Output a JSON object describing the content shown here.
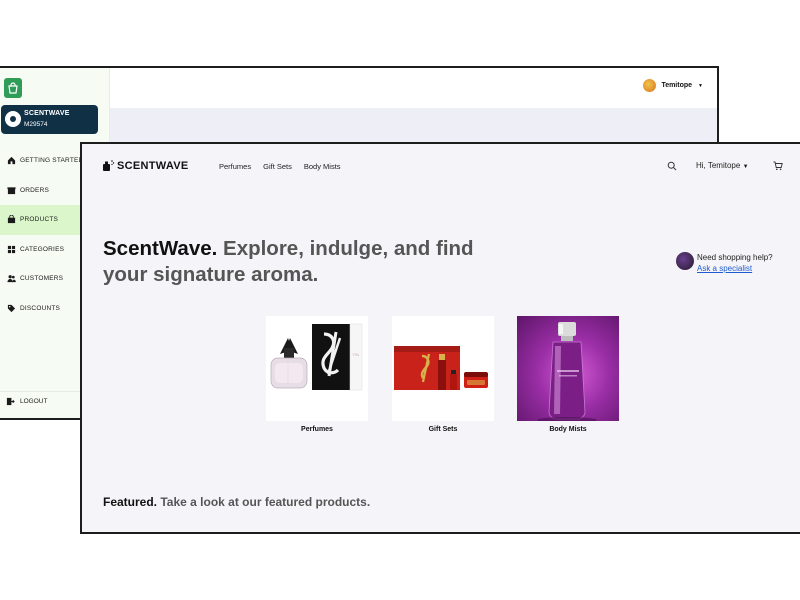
{
  "admin": {
    "store": {
      "name": "SCENTWAVE",
      "id": "M29574"
    },
    "nav": [
      {
        "label": "GETTING STARTED",
        "icon": "home-icon",
        "active": false
      },
      {
        "label": "ORDERS",
        "icon": "box-icon",
        "active": false
      },
      {
        "label": "PRODUCTS",
        "icon": "shopping-bag-icon",
        "active": true
      },
      {
        "label": "CATEGORIES",
        "icon": "grid-icon",
        "active": false
      },
      {
        "label": "CUSTOMERS",
        "icon": "users-icon",
        "active": false
      },
      {
        "label": "DISCOUNTS",
        "icon": "tag-icon",
        "active": false
      }
    ],
    "logout_label": "LOGOUT",
    "user_name": "Temitope",
    "accent_color": "#2f9c57",
    "active_nav_color": "#dcf6cc",
    "store_card_color": "#103046"
  },
  "storefront": {
    "brand": "SCENTWAVE",
    "menu": [
      "Perfumes",
      "Gift Sets",
      "Body Mists"
    ],
    "greeting": "Hi, Temitope",
    "hero": {
      "brand_word": "ScentWave.",
      "tagline": "Explore, indulge, and find your signature aroma."
    },
    "help": {
      "prompt": "Need shopping help?",
      "link": "Ask a specialist"
    },
    "categories": [
      {
        "label": "Perfumes"
      },
      {
        "label": "Gift Sets"
      },
      {
        "label": "Body Mists"
      }
    ],
    "featured": {
      "title": "Featured.",
      "subtitle": "Take a look at our featured products."
    },
    "link_color": "#1d5ccf"
  }
}
